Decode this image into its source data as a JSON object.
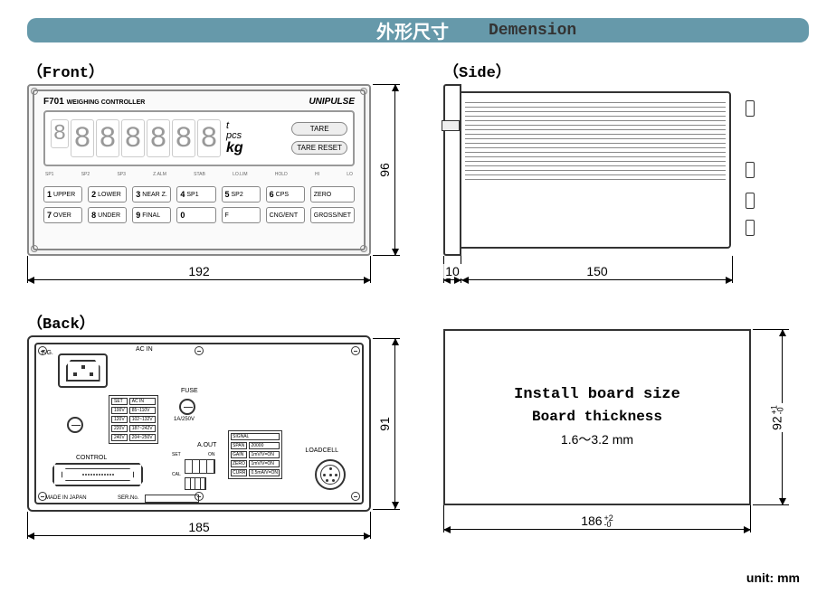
{
  "header": {
    "cn": "外形尺寸",
    "en": "Demension"
  },
  "views": {
    "front": {
      "label": "（Front）"
    },
    "side": {
      "label": "（Side）"
    },
    "back": {
      "label": "（Back）"
    }
  },
  "front_panel": {
    "model": "F701",
    "subtitle": "WEIGHING CONTROLLER",
    "brand": "UNIPULSE",
    "display_digits": [
      "8",
      "8",
      "8",
      "8",
      "8",
      "8",
      "8"
    ],
    "units": {
      "top": "t",
      "mid": "pcs",
      "bottom": "kg"
    },
    "lcd_buttons": [
      "TARE",
      "TARE RESET"
    ],
    "indicator_row": [
      "SP1",
      "SP2",
      "SP3",
      "Z.ALM",
      "STAB",
      "LO.LIM",
      "HOLD",
      "HI",
      "LO"
    ],
    "keys_row1": [
      {
        "n": "1",
        "l": "UPPER"
      },
      {
        "n": "2",
        "l": "LOWER"
      },
      {
        "n": "3",
        "l": "NEAR Z."
      },
      {
        "n": "4",
        "l": "SP1"
      },
      {
        "n": "5",
        "l": "SP2"
      },
      {
        "n": "6",
        "l": "CPS"
      },
      {
        "n": "",
        "l": "ZERO"
      }
    ],
    "keys_row2": [
      {
        "n": "7",
        "l": "OVER"
      },
      {
        "n": "8",
        "l": "UNDER"
      },
      {
        "n": "9",
        "l": "FINAL"
      },
      {
        "n": "0",
        "l": ""
      },
      {
        "n": "",
        "l": "F"
      },
      {
        "n": "",
        "l": "CNG/ENT"
      },
      {
        "n": "",
        "l": "GROSS/NET"
      }
    ]
  },
  "back_panel": {
    "fg_label": "F.G.",
    "ac_in_label": "AC IN",
    "fuse_label": "FUSE",
    "fuse_rating": "1A/250V",
    "voltage_table_header": [
      "SET",
      "AC IN"
    ],
    "voltage_table": [
      [
        "100V",
        "85~110V"
      ],
      [
        "120V",
        "102~132V"
      ],
      [
        "220V",
        "187~242V"
      ],
      [
        "240V",
        "204~250V"
      ]
    ],
    "control_label": "CONTROL",
    "aout_label": "A.OUT",
    "set_label": "SET",
    "cal_label": "CAL",
    "on_label": "ON",
    "loadcell_label": "LOADCELL",
    "signal_header": "SIGNAL",
    "signal_table": [
      [
        "SPAN",
        "20000"
      ],
      [
        "GAIN",
        "1mV/V=ON"
      ],
      [
        "ZERO",
        "1mV/V=ON"
      ],
      [
        "CURR",
        "0.5mA/V=ON"
      ]
    ],
    "made_label": "MADE IN JAPAN",
    "ser_label": "SER.No."
  },
  "install": {
    "line1": "Install board size",
    "line2": "Board thickness",
    "line3": "1.6～3.2 mm"
  },
  "dimensions": {
    "front_w": "192",
    "front_h": "96",
    "side_flange": "10",
    "side_depth": "150",
    "back_w": "185",
    "back_h": "91",
    "install_w": "186",
    "install_w_tol_top": "+2",
    "install_w_tol_bot": "-0",
    "install_h": "92",
    "install_h_tol_top": "+1",
    "install_h_tol_bot": "-0"
  },
  "unit_note": "unit: mm"
}
